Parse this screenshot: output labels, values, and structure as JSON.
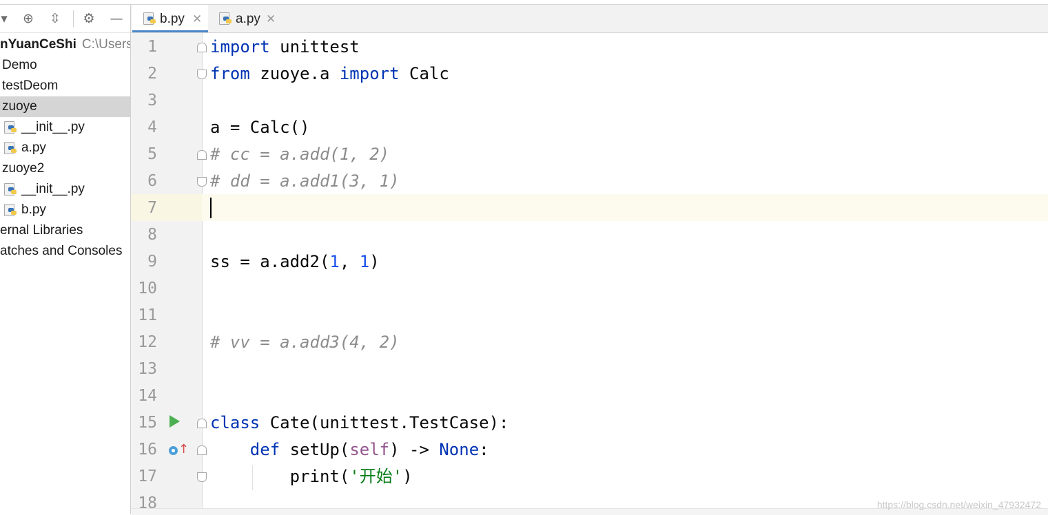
{
  "sidebar": {
    "toolbar_icons": [
      "dropdown-icon",
      "locate-icon",
      "collapse-icon",
      "gear-icon",
      "minimize-icon"
    ],
    "project_name": "nYuanCeShi",
    "project_path": "C:\\Users\\",
    "tree": [
      {
        "label": "Demo"
      },
      {
        "label": "testDeom"
      },
      {
        "label": "zuoye"
      },
      {
        "label": "__init__.py"
      },
      {
        "label": "a.py"
      },
      {
        "label": "zuoye2"
      },
      {
        "label": "__init__.py"
      },
      {
        "label": "b.py"
      },
      {
        "label": "ernal Libraries"
      },
      {
        "label": "atches and Consoles"
      }
    ]
  },
  "tabs": [
    {
      "label": "b.py",
      "active": true
    },
    {
      "label": "a.py",
      "active": false
    }
  ],
  "editor": {
    "line_numbers": [
      "1",
      "2",
      "3",
      "4",
      "5",
      "6",
      "7",
      "8",
      "9",
      "10",
      "11",
      "12",
      "13",
      "14",
      "15",
      "16",
      "17",
      "18"
    ],
    "line1": {
      "kw": "import",
      "rest": " unittest"
    },
    "line2": {
      "kw1": "from",
      "mid": " zuoye.a ",
      "kw2": "import",
      "rest": " Calc"
    },
    "line4": "a = Calc()",
    "line5": "# cc = a.add(1, 2)",
    "line6": "# dd = a.add1(3, 1)",
    "line9": {
      "pre": "ss = a.add2(",
      "n1": "1",
      "sep": ", ",
      "n2": "1",
      "post": ")"
    },
    "line12": "# vv = a.add3(4, 2)",
    "line15": {
      "kw": "class",
      "rest": " Cate(unittest.TestCase):"
    },
    "line16": {
      "indent": "    ",
      "kw": "def",
      "name": " setUp(",
      "self": "self",
      "mid": ") -> ",
      "none": "None",
      "post": ":"
    },
    "line17": {
      "indent": "        ",
      "fn": "print(",
      "str": "'开始'",
      "post": ")"
    }
  },
  "watermark": "https://blog.csdn.net/weixin_47932472",
  "colors": {
    "keyword": "#0033b3",
    "comment": "#8c8c8c",
    "number": "#1750eb",
    "self": "#94558d",
    "string": "#067d17",
    "tab_underline": "#4a86c8"
  }
}
